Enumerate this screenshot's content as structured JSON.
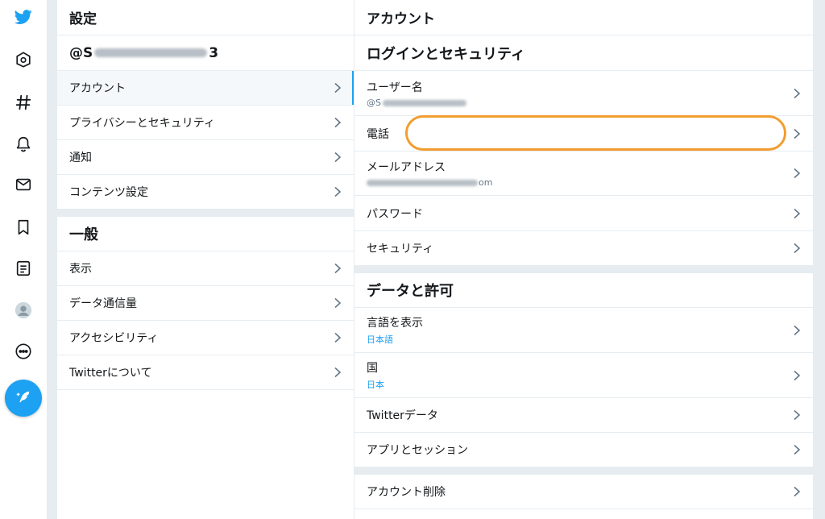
{
  "left": {
    "header": "設定",
    "handle_prefix": "@S",
    "handle_suffix": "3",
    "account_items": [
      {
        "label": "アカウント"
      },
      {
        "label": "プライバシーとセキュリティ"
      },
      {
        "label": "通知"
      },
      {
        "label": "コンテンツ設定"
      }
    ],
    "general_title": "一般",
    "general_items": [
      {
        "label": "表示"
      },
      {
        "label": "データ通信量"
      },
      {
        "label": "アクセシビリティ"
      },
      {
        "label": "Twitterについて"
      }
    ]
  },
  "right": {
    "header": "アカウント",
    "login_title": "ログインとセキュリティ",
    "username": {
      "label": "ユーザー名",
      "value_prefix": "@S"
    },
    "phone": {
      "label": "電話"
    },
    "email": {
      "label": "メールアドレス",
      "value_suffix": "om"
    },
    "password": {
      "label": "パスワード"
    },
    "security": {
      "label": "セキュリティ"
    },
    "data_title": "データと許可",
    "language": {
      "label": "言語を表示",
      "value": "日本語"
    },
    "country": {
      "label": "国",
      "value": "日本"
    },
    "twitter_data": {
      "label": "Twitterデータ"
    },
    "apps": {
      "label": "アプリとセッション"
    },
    "delete": {
      "label": "アカウント削除"
    }
  },
  "nav_icons": [
    "twitter-bird-icon",
    "home-icon",
    "hashtag-icon",
    "bell-icon",
    "mail-icon",
    "bookmark-icon",
    "list-icon",
    "profile-avatar",
    "more-icon",
    "compose-tweet-icon"
  ],
  "colors": {
    "accent": "#1da1f2",
    "highlight": "#f29d2f",
    "gutter": "#e6ecf0"
  }
}
